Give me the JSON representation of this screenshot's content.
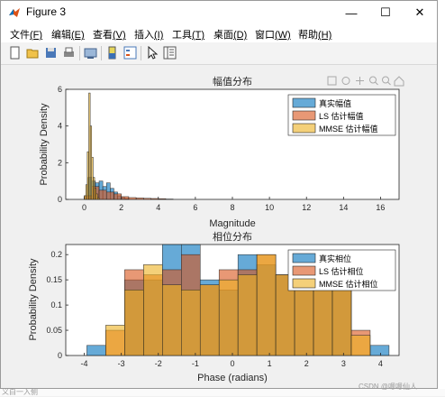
{
  "window": {
    "title": "Figure 3",
    "controls": {
      "minimize": "—",
      "maximize": "☐",
      "close": "✕"
    }
  },
  "menu": [
    {
      "label": "文件",
      "key": "(F)"
    },
    {
      "label": "编辑",
      "key": "(E)"
    },
    {
      "label": "查看",
      "key": "(V)"
    },
    {
      "label": "插入",
      "key": "(I)"
    },
    {
      "label": "工具",
      "key": "(T)"
    },
    {
      "label": "桌面",
      "key": "(D)"
    },
    {
      "label": "窗口",
      "key": "(W)"
    },
    {
      "label": "帮助",
      "key": "(H)"
    }
  ],
  "toolbar": [
    "new-figure-icon",
    "open-file-icon",
    "save-icon",
    "print-icon",
    "link-figure-icon",
    "colorbar-icon",
    "legend-icon",
    "pointer-icon",
    "property-editor-icon"
  ],
  "colors": {
    "true": "#0072BD",
    "ls": "#D95319",
    "mmse": "#EDB120"
  },
  "chart_data": [
    {
      "type": "bar",
      "title": "幅值分布",
      "xlabel": "Magnitude",
      "ylabel": "Probability Density",
      "xlim": [
        -1,
        17
      ],
      "ylim": [
        0,
        6
      ],
      "xticks": [
        0,
        2,
        4,
        6,
        8,
        10,
        12,
        14,
        16
      ],
      "yticks": [
        0,
        2,
        4,
        6
      ],
      "legend_position": "top-right",
      "grid": false,
      "series": [
        {
          "name": "真实幅值",
          "color": "#0072BD",
          "bins": [
            [
              0.2,
              0.4,
              1.2
            ],
            [
              0.4,
              0.6,
              1.0
            ],
            [
              0.6,
              0.8,
              0.9
            ],
            [
              0.8,
              1.0,
              1.0
            ],
            [
              1.0,
              1.2,
              0.7
            ],
            [
              1.2,
              1.4,
              0.9
            ],
            [
              1.4,
              1.6,
              0.6
            ],
            [
              1.6,
              1.8,
              0.4
            ],
            [
              1.8,
              2.0,
              0.2
            ],
            [
              2.0,
              2.2,
              0.1
            ],
            [
              2.2,
              2.4,
              0.05
            ]
          ]
        },
        {
          "name": "LS 估计幅值",
          "color": "#D95319",
          "bins": [
            [
              0.0,
              0.4,
              0.2
            ],
            [
              0.4,
              0.8,
              0.7
            ],
            [
              0.8,
              1.2,
              0.5
            ],
            [
              1.2,
              1.6,
              0.4
            ],
            [
              1.6,
              2.0,
              0.3
            ],
            [
              2.0,
              2.4,
              0.15
            ],
            [
              2.4,
              2.8,
              0.1
            ],
            [
              2.8,
              3.2,
              0.08
            ],
            [
              3.2,
              3.6,
              0.06
            ],
            [
              3.6,
              4.0,
              0.05
            ],
            [
              4.0,
              4.4,
              0.04
            ],
            [
              4.4,
              4.8,
              0.02
            ]
          ]
        },
        {
          "name": "MMSE 估计幅值",
          "color": "#EDB120",
          "bins": [
            [
              0.0,
              0.08,
              0.2
            ],
            [
              0.08,
              0.16,
              0.8
            ],
            [
              0.16,
              0.24,
              2.6
            ],
            [
              0.24,
              0.32,
              5.8
            ],
            [
              0.32,
              0.4,
              4.0
            ],
            [
              0.4,
              0.48,
              2.3
            ],
            [
              0.48,
              0.56,
              1.2
            ],
            [
              0.56,
              0.64,
              0.6
            ],
            [
              0.64,
              0.72,
              0.3
            ],
            [
              0.72,
              0.8,
              0.1
            ]
          ]
        }
      ]
    },
    {
      "type": "bar",
      "title": "相位分布",
      "xlabel": "Phase (radians)",
      "ylabel": "Probability Density",
      "xlim": [
        -4.5,
        4.5
      ],
      "ylim": [
        0,
        0.22
      ],
      "xticks": [
        -4,
        -3,
        -2,
        -1,
        0,
        1,
        2,
        3,
        4
      ],
      "yticks": [
        0,
        0.05,
        0.1,
        0.15,
        0.2
      ],
      "legend_position": "top-right",
      "grid": false,
      "bin_edges": [
        -3.93,
        -3.42,
        -2.91,
        -2.4,
        -1.89,
        -1.38,
        -0.87,
        -0.36,
        0.15,
        0.66,
        1.17,
        1.68,
        2.19,
        2.7,
        3.21,
        3.72,
        4.23
      ],
      "series": [
        {
          "name": "真实相位",
          "color": "#0072BD",
          "values": [
            0.02,
            0.0,
            0.15,
            0.15,
            0.23,
            0.22,
            0.15,
            0.13,
            0.2,
            0.18,
            0.16,
            0.13,
            0.14,
            0.16,
            0.0,
            0.02
          ]
        },
        {
          "name": "LS 估计相位",
          "color": "#D95319",
          "values": [
            0.0,
            0.05,
            0.17,
            0.16,
            0.17,
            0.2,
            0.14,
            0.17,
            0.17,
            0.2,
            0.16,
            0.17,
            0.16,
            0.14,
            0.05,
            0.0
          ]
        },
        {
          "name": "MMSE 估计相位",
          "color": "#EDB120",
          "values": [
            0.0,
            0.06,
            0.13,
            0.18,
            0.14,
            0.13,
            0.14,
            0.15,
            0.16,
            0.2,
            0.16,
            0.14,
            0.15,
            0.13,
            0.04,
            0.0
          ]
        }
      ]
    }
  ],
  "watermark": {
    "left": "义白一入侧",
    "right": "CSDN @嗯嗯仙人"
  }
}
